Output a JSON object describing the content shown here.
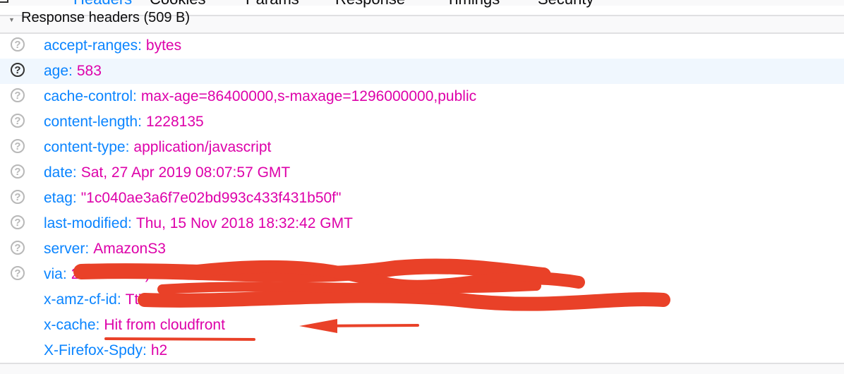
{
  "tabs": [
    {
      "label": "Headers",
      "selected": true
    },
    {
      "label": "Cookies"
    },
    {
      "label": "Params"
    },
    {
      "label": "Response"
    },
    {
      "label": "Timings"
    },
    {
      "label": "Security"
    }
  ],
  "section": {
    "label": "Response headers (509 B)"
  },
  "headers": [
    {
      "name": "accept-ranges:",
      "value": "bytes"
    },
    {
      "name": "age:",
      "value": "583"
    },
    {
      "name": "cache-control:",
      "value": "max-age=86400000,s-maxage=1296000000,public"
    },
    {
      "name": "content-length:",
      "value": "1228135"
    },
    {
      "name": "content-type:",
      "value": "application/javascript"
    },
    {
      "name": "date:",
      "value": "Sat, 27 Apr 2019 08:07:57 GMT"
    },
    {
      "name": "etag:",
      "value": "\"1c040ae3a6f7e02bd993c433f431b50f\""
    },
    {
      "name": "last-modified:",
      "value": "Thu, 15 Nov 2018 18:32:42 GMT"
    },
    {
      "name": "server:",
      "value": "AmazonS3"
    },
    {
      "name": "via:",
      "value": "2f7265f17 t)"
    },
    {
      "name": "x-amz-cf-id:",
      "value": "TtTzrk ANp8G7AfsRV"
    },
    {
      "name": "x-cache:",
      "value": "Hit from cloudfront"
    },
    {
      "name": "X-Firefox-Spdy:",
      "value": "h2"
    }
  ],
  "colors": {
    "accent": "#0a84ff",
    "value": "#dd00a9",
    "annotation": "#e94128"
  }
}
